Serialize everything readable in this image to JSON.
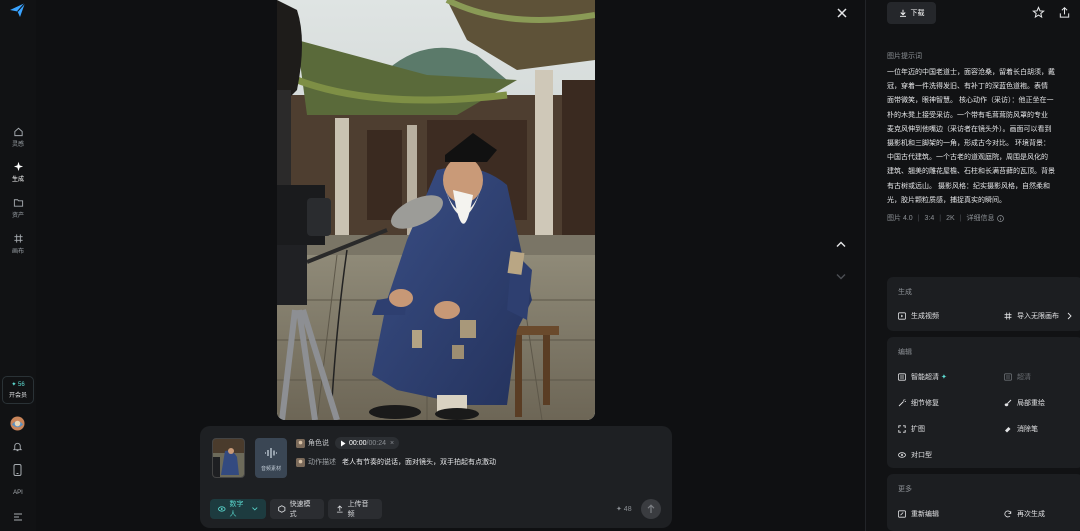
{
  "rail": {
    "items": [
      {
        "label": "灵感"
      },
      {
        "label": "生成"
      },
      {
        "label": "资产"
      },
      {
        "label": "画布"
      }
    ],
    "member": {
      "count": "✦ 56",
      "label": "开会员"
    },
    "api_label": "API"
  },
  "composer": {
    "role_label": "角色说",
    "audio_current": "00:00",
    "audio_total": "/00:24",
    "audio_card_label": "音频素材",
    "action_tag": "动作描述",
    "action_text": "老人有节奏的说话，面对镜头，双手拍起有点激动",
    "buttons": {
      "digital": "数字人",
      "fast": "快速模式",
      "upload": "上传音频"
    },
    "credits": "✦ 48"
  },
  "right": {
    "download_label": "下载",
    "prompt_title": "图片提示词",
    "prompt_lines": [
      "一位年迈的中国老道士，面容沧桑，留着长白胡须，戴",
      "冠，穿着一件洗得发旧、有补丁的深蓝色道袍。表情",
      "面带微笑，眼神智慧。 核心动作（采访）：他正坐在一",
      "朴的木凳上接受采访。一个带有毛茸茸防风罩的专业",
      "麦克风伸到他嘴边（采访者在镜头外）。画面可以看到",
      "摄影机和三脚架的一角，形成古今对比。 环境背景：",
      "中国古代建筑。一个古老的道观庭院，周围是风化的",
      "建筑、翘美的雕花屋檐、石柱和长满苔藓的瓦顶。背景",
      "有古树或远山。 摄影风格：纪实摄影风格，自然柔和",
      "光，胶片颗粒质感，捕捉真实的瞬间。"
    ],
    "meta": {
      "model": "图片 4.0",
      "ratio": "3:4",
      "resolution": "2K",
      "details": "详细信息"
    },
    "generate": {
      "title": "生成",
      "video": "生成视频",
      "import": "导入无限画布"
    },
    "edit": {
      "title": "编辑",
      "smart_hd": "智能超清",
      "hd": "超清",
      "detail_fix": "细节修复",
      "local_redraw": "局部重绘",
      "expand": "扩图",
      "eliminate": "消除笔",
      "lip_sync": "对口型"
    },
    "more": {
      "title": "更多",
      "re_edit": "重新编辑",
      "regenerate": "再次生成"
    }
  }
}
